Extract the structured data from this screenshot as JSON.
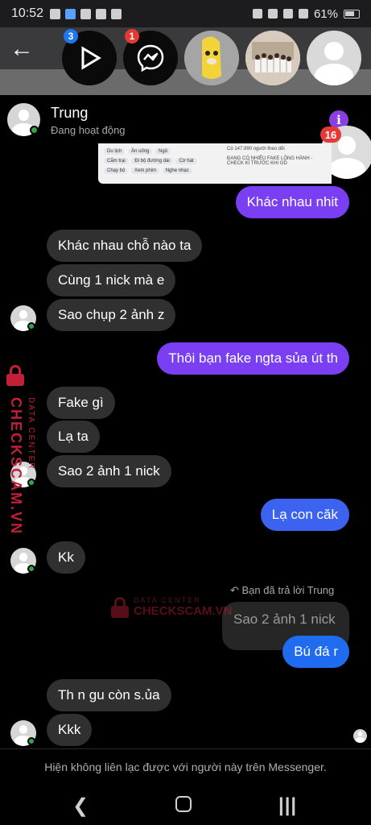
{
  "status": {
    "time": "10:52",
    "battery": "61%"
  },
  "heads": [
    {
      "name": "video-app-head",
      "badge": "3",
      "badge_color": "#1e77f2"
    },
    {
      "name": "messenger-head",
      "badge": "1",
      "badge_color": "#e53935"
    },
    {
      "name": "banana-cat-head",
      "badge": ""
    },
    {
      "name": "group-photo-head",
      "badge": ""
    },
    {
      "name": "default-avatar-head",
      "badge": ""
    }
  ],
  "side_head_badge": "16",
  "chat": {
    "contact_name": "Trung",
    "contact_status": "Đang hoạt động",
    "shared_image_text": {
      "followers": "Có 147.990 người theo dõi",
      "line1": "ĐANG CÓ NHIỀU FAKE LỘNG HÀNH -",
      "line2": "CHECK KĨ TRƯỚC KHI GD",
      "chips": [
        "Du lịch",
        "Ăn uống",
        "Ngủ",
        "Cắm trại",
        "Đi bộ đường dài",
        "Cờ hát",
        "Chạy bộ",
        "Xem phim",
        "Nghe nhạc"
      ]
    },
    "messages": [
      {
        "id": "m1",
        "side": "out",
        "text": "Khác nhau nhit"
      },
      {
        "id": "m2",
        "side": "in",
        "text": "Khác nhau chỗ nào ta"
      },
      {
        "id": "m3",
        "side": "in",
        "text": "Cùng 1 nick mà e"
      },
      {
        "id": "m4",
        "side": "in",
        "text": "Sao chụp 2 ảnh z"
      },
      {
        "id": "m5",
        "side": "out",
        "text": "Thôi bạn fake ngta sủa út th"
      },
      {
        "id": "m6",
        "side": "in",
        "text": "Fake gì"
      },
      {
        "id": "m7",
        "side": "in",
        "text": "Lạ ta"
      },
      {
        "id": "m8",
        "side": "in",
        "text": "Sao 2 ảnh 1 nick"
      },
      {
        "id": "m9",
        "side": "out",
        "text": "Lạ con căk"
      },
      {
        "id": "m10",
        "side": "in",
        "text": "Kk"
      },
      {
        "id": "m11",
        "side": "out",
        "text": "Bú đá r"
      },
      {
        "id": "m12",
        "side": "in",
        "text": "Th n gu còn s.ủa"
      },
      {
        "id": "m13",
        "side": "in",
        "text": "Kkk"
      }
    ],
    "reply_note": "Bạn đã trả lời Trung",
    "reply_quote": "Sao 2 ảnh 1 nick",
    "bottom_notice": "Hiện không liên lạc được với người này trên Messenger."
  },
  "watermark": {
    "top": "DATA CENTER",
    "main": "CHECKSCAM.VN"
  },
  "colors": {
    "accent_purple": "#7a3ff2",
    "accent_blue": "#3b63f0",
    "incoming_bubble": "#303030",
    "watermark_red": "#c22036"
  }
}
